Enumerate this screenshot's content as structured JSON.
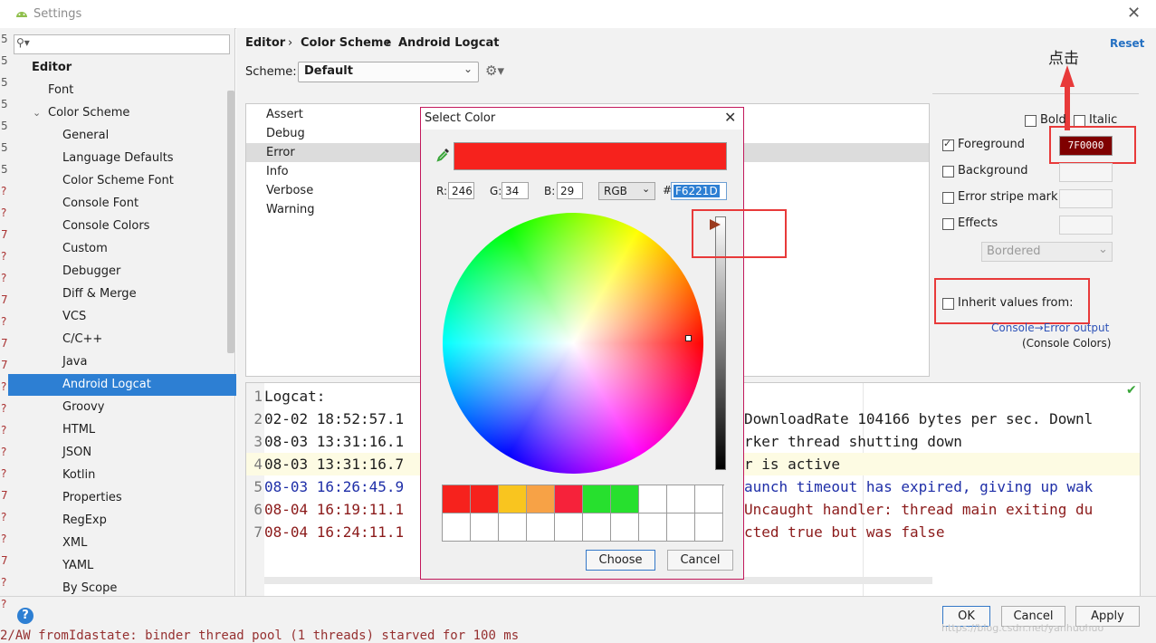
{
  "window": {
    "title": "Settings"
  },
  "search": {
    "placeholder": ""
  },
  "tree": {
    "items": [
      {
        "label": "Editor",
        "level": 0,
        "bold": true
      },
      {
        "label": "Font",
        "level": 1
      },
      {
        "label": "Color Scheme",
        "level": 1,
        "expanded": true
      },
      {
        "label": "General",
        "level": 2
      },
      {
        "label": "Language Defaults",
        "level": 2
      },
      {
        "label": "Color Scheme Font",
        "level": 2
      },
      {
        "label": "Console Font",
        "level": 2
      },
      {
        "label": "Console Colors",
        "level": 2
      },
      {
        "label": "Custom",
        "level": 2
      },
      {
        "label": "Debugger",
        "level": 2
      },
      {
        "label": "Diff & Merge",
        "level": 2
      },
      {
        "label": "VCS",
        "level": 2
      },
      {
        "label": "C/C++",
        "level": 2
      },
      {
        "label": "Java",
        "level": 2
      },
      {
        "label": "Android Logcat",
        "level": 2,
        "selected": true
      },
      {
        "label": "Groovy",
        "level": 2
      },
      {
        "label": "HTML",
        "level": 2
      },
      {
        "label": "JSON",
        "level": 2
      },
      {
        "label": "Kotlin",
        "level": 2
      },
      {
        "label": "Properties",
        "level": 2
      },
      {
        "label": "RegExp",
        "level": 2
      },
      {
        "label": "XML",
        "level": 2
      },
      {
        "label": "YAML",
        "level": 2
      },
      {
        "label": "By Scope",
        "level": 2
      }
    ]
  },
  "breadcrumb": {
    "items": [
      "Editor",
      "Color Scheme",
      "Android Logcat"
    ],
    "separator": "›"
  },
  "reset_label": "Reset",
  "scheme": {
    "label": "Scheme:",
    "value": "Default"
  },
  "attributes": {
    "items": [
      "Assert",
      "Debug",
      "Error",
      "Info",
      "Verbose",
      "Warning"
    ],
    "selected": "Error"
  },
  "style_options": {
    "bold": {
      "label": "Bold",
      "checked": false
    },
    "italic": {
      "label": "Italic",
      "checked": false
    },
    "foreground": {
      "label": "Foreground",
      "checked": true,
      "value": "7F0000",
      "color": "#7f0000"
    },
    "background": {
      "label": "Background",
      "checked": false
    },
    "error_stripe": {
      "label": "Error stripe mark",
      "checked": false
    },
    "effects": {
      "label": "Effects",
      "checked": false,
      "dropdown": "Bordered"
    },
    "inherit": {
      "label": "Inherit values from:",
      "checked": false,
      "link": "Console→Error output",
      "source": "(Console Colors)"
    }
  },
  "annotation": {
    "text": "点击",
    "color": "#e83a3a"
  },
  "preview": {
    "lines": [
      {
        "n": "1",
        "left": "Logcat:",
        "right": "",
        "color": "#1e1e1e"
      },
      {
        "n": "2",
        "left": "02-02 18:52:57.1",
        "right": "DownloadRate 104166 bytes per sec. Downl",
        "color": "#1e1e1e"
      },
      {
        "n": "3",
        "left": "08-03 13:31:16.1",
        "right": "rker thread shutting down",
        "color": "#1e1e1e"
      },
      {
        "n": "4",
        "left": "08-03 13:31:16.7",
        "right": "r is active",
        "color": "#1e1e1e",
        "highlight": true
      },
      {
        "n": "5",
        "left": "08-03 16:26:45.9",
        "right": "aunch timeout has expired, giving up wak",
        "color": "#1f2fa8"
      },
      {
        "n": "6",
        "left": "08-04 16:19:11.1",
        "right": "Uncaught handler: thread main exiting du",
        "color": "#8b1a1a"
      },
      {
        "n": "7",
        "left": "08-04 16:24:11.1",
        "right": "cted true but was false",
        "color": "#8b1a1a"
      }
    ]
  },
  "background_digits": [
    "5",
    "5",
    "5",
    "5",
    "5",
    "5",
    "5",
    "?",
    "?",
    "7",
    "?",
    "?",
    "7",
    "?",
    "7",
    "7",
    "?",
    "?",
    "?",
    "?",
    "?",
    "7",
    "?",
    "?",
    "7",
    "?",
    "?"
  ],
  "background_text": "2/AW fromIdastate: binder thread pool (1 threads) starved for 100 ms",
  "color_dialog": {
    "title": "Select Color",
    "current_color": "#f6221d",
    "r_label": "R:",
    "r": "246",
    "g_label": "G:",
    "g": "34",
    "b_label": "B:",
    "b": "29",
    "mode": "RGB",
    "hash": "#",
    "hex": "F6221D",
    "recent_colors": [
      "#f6221d",
      "#f6221d",
      "#f9c51f",
      "#f7a246",
      "#f6223a",
      "#27e02e",
      "#27e02e",
      "#ffffff",
      "#ffffff",
      "#ffffff",
      "#ffffff",
      "#ffffff",
      "#ffffff",
      "#ffffff",
      "#ffffff",
      "#ffffff",
      "#ffffff",
      "#ffffff",
      "#ffffff",
      "#ffffff"
    ],
    "choose_label": "Choose",
    "cancel_label": "Cancel"
  },
  "footer": {
    "ok_label": "OK",
    "cancel_label": "Cancel",
    "apply_label": "Apply",
    "watermark": "https://blog.csdn.net/yanhuohuo"
  }
}
